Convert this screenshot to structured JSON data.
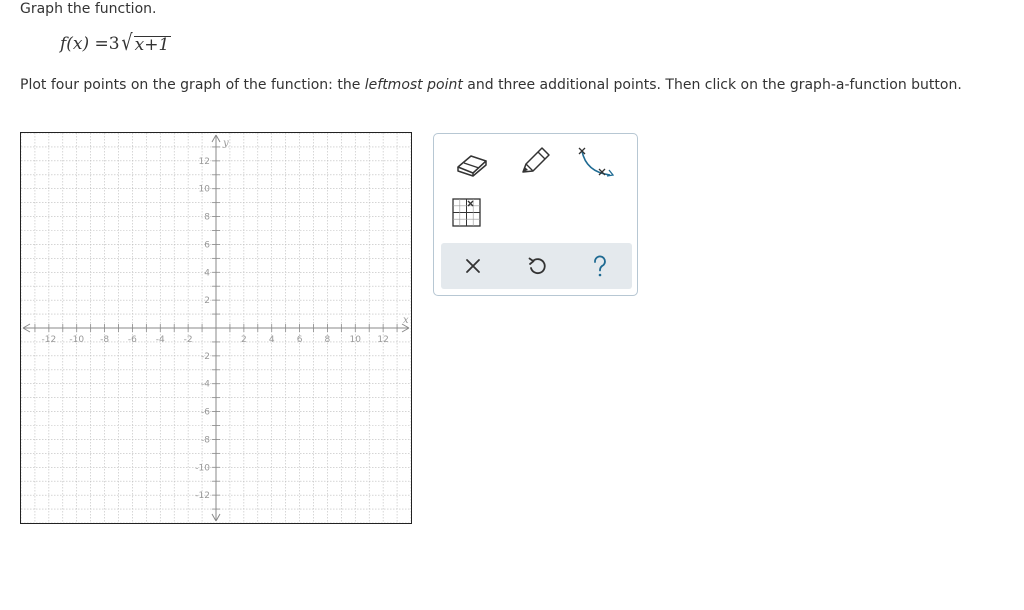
{
  "question": {
    "heading": "Graph the function.",
    "formula": {
      "lhs": "f(x) = ",
      "coefficient": "3",
      "radicand": "x+1"
    },
    "instruction": {
      "part1": "Plot four points on the graph of the function: the ",
      "emphasis": "leftmost point",
      "part2": " and three additional points. Then click on the graph-a-function button."
    }
  },
  "graph": {
    "x_axis_label": "x",
    "y_axis_label": "y",
    "xlim": [
      -14,
      14
    ],
    "ylim": [
      -14,
      14
    ],
    "grid": true,
    "x_tick_labels": [
      "-12",
      "-10",
      "-8",
      "-6",
      "-4",
      "-2",
      "2",
      "4",
      "6",
      "8",
      "10",
      "12"
    ],
    "y_tick_labels": [
      "12",
      "10",
      "8",
      "6",
      "4",
      "2",
      "-2",
      "-4",
      "-6",
      "-8",
      "-10",
      "-12"
    ],
    "colors": {
      "grid": "#bcbcbc",
      "axis": "#8a8a8a",
      "tick_label": "#999999",
      "border": "#222222"
    }
  },
  "toolbox": {
    "tools": [
      "eraser-icon",
      "pencil-icon",
      "curve-graph-icon",
      "point-grid-icon"
    ],
    "actions": [
      "close-icon",
      "undo-icon",
      "help-icon"
    ],
    "colors": {
      "accent": "#1e6a92",
      "border": "#b7c7d3",
      "action_bg": "#e4e9ed"
    }
  }
}
